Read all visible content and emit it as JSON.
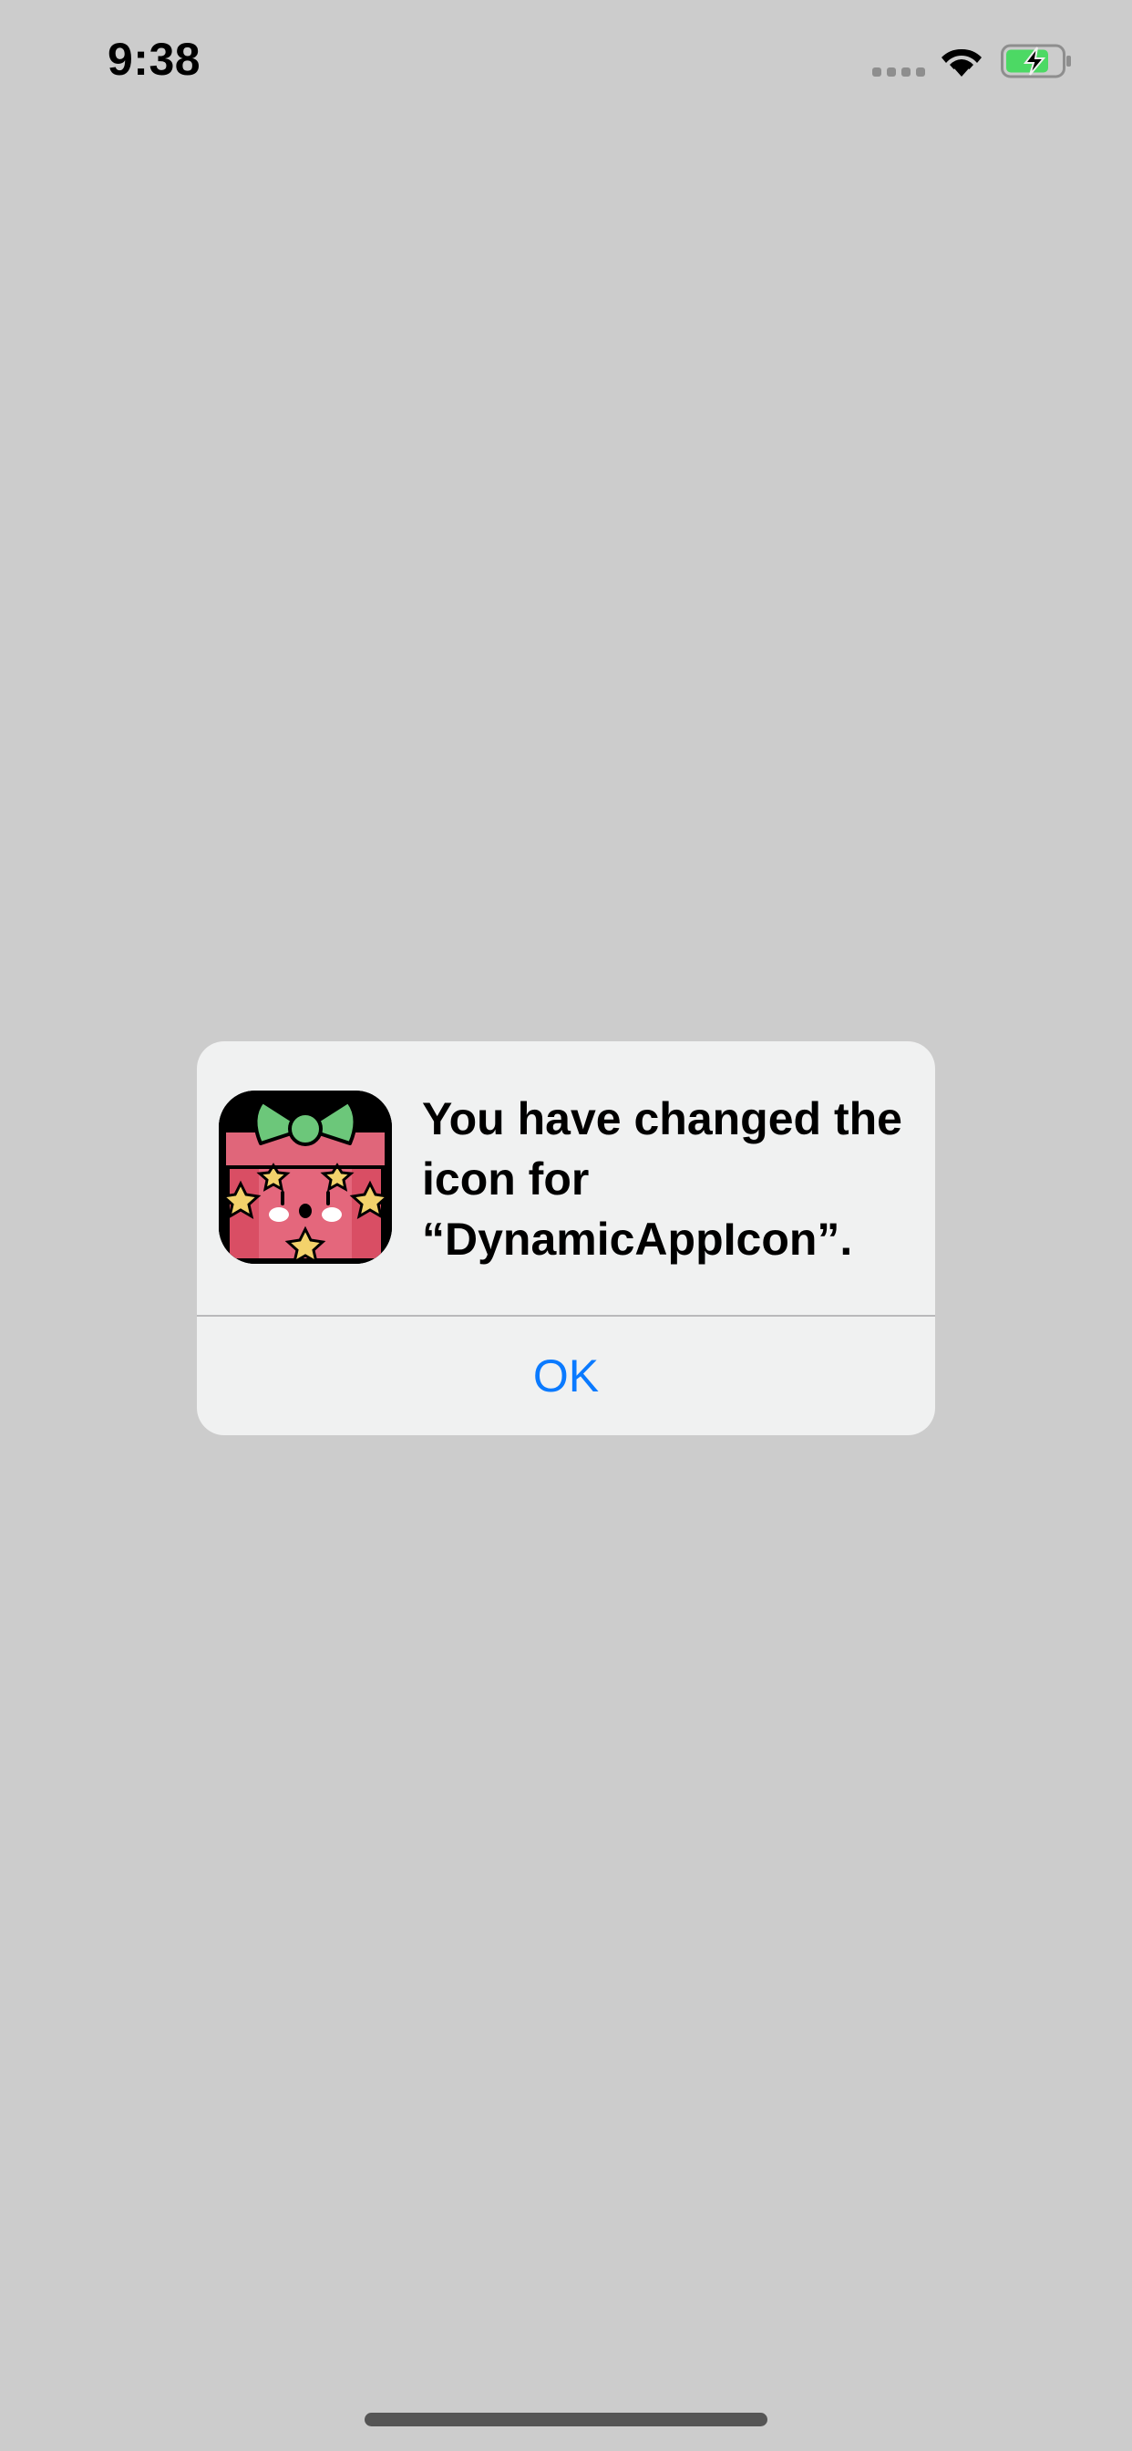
{
  "status_bar": {
    "time": "9:38",
    "icons": [
      "cellular-signal-icon",
      "wifi-icon",
      "battery-charging-icon"
    ]
  },
  "alert": {
    "message": "You have changed the icon for “DynamicAppIcon”.",
    "ok_label": "OK",
    "app_icon": "gift-box-app-icon"
  },
  "colors": {
    "background": "#cccccc",
    "alert_background": "#f0f1f1",
    "button_blue": "#0a7aff",
    "battery_green": "#4cd964"
  }
}
